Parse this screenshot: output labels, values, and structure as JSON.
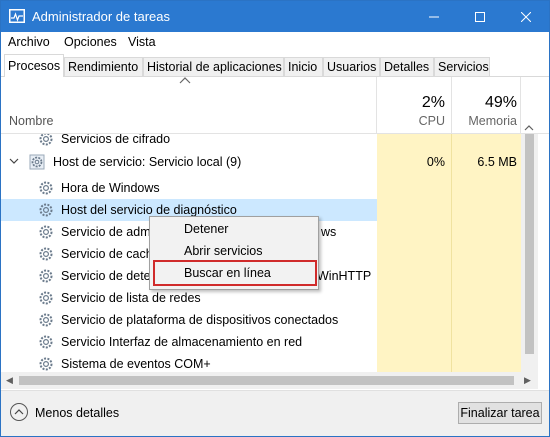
{
  "window": {
    "title": "Administrador de tareas"
  },
  "menu": [
    "Archivo",
    "Opciones",
    "Vista"
  ],
  "tabs": [
    "Procesos",
    "Rendimiento",
    "Historial de aplicaciones",
    "Inicio",
    "Usuarios",
    "Detalles",
    "Servicios"
  ],
  "header": {
    "name_label": "Nombre",
    "cpu_pct": "2%",
    "cpu_label": "CPU",
    "mem_pct": "49%",
    "mem_label": "Memoria"
  },
  "rows": [
    {
      "label": "Servicios de cifrado",
      "cpu": "",
      "mem": ""
    },
    {
      "label": "Host de servicio: Servicio local (9)",
      "cpu": "0%",
      "mem": "6.5 MB"
    },
    {
      "label": "Hora de Windows",
      "cpu": "",
      "mem": ""
    },
    {
      "label": "Host del servicio de diagnóstico",
      "cpu": "",
      "mem": ""
    },
    {
      "label": "Servicio de administración de red remota de Windows",
      "cpu": "",
      "mem": ""
    },
    {
      "label": "Servicio de caché",
      "cpu": "",
      "mem": ""
    },
    {
      "label": "Servicio de detección automática de proxy web WinHTTP",
      "cpu": "",
      "mem": ""
    },
    {
      "label": "Servicio de lista de redes",
      "cpu": "",
      "mem": ""
    },
    {
      "label": "Servicio de plataforma de dispositivos conectados",
      "cpu": "",
      "mem": ""
    },
    {
      "label": "Servicio Interfaz de almacenamiento en red",
      "cpu": "",
      "mem": ""
    },
    {
      "label": "Sistema de eventos COM+",
      "cpu": "",
      "mem": ""
    }
  ],
  "visible_text": {
    "row4": "Servicio de admi",
    "row4_tail": "ws",
    "row5": "Servicio de cache",
    "row6": "Servicio de detec",
    "row6_tail": "WinHTTP"
  },
  "context_menu": [
    "Detener",
    "Abrir servicios",
    "Buscar en línea"
  ],
  "footer": {
    "fewer_details": "Menos detalles",
    "end_task": "Finalizar tarea"
  },
  "colors": {
    "titlebar": "#2b79d0",
    "heat": "#fff4c4",
    "selection": "#cce8ff",
    "highlight_box": "#d02b2b"
  }
}
